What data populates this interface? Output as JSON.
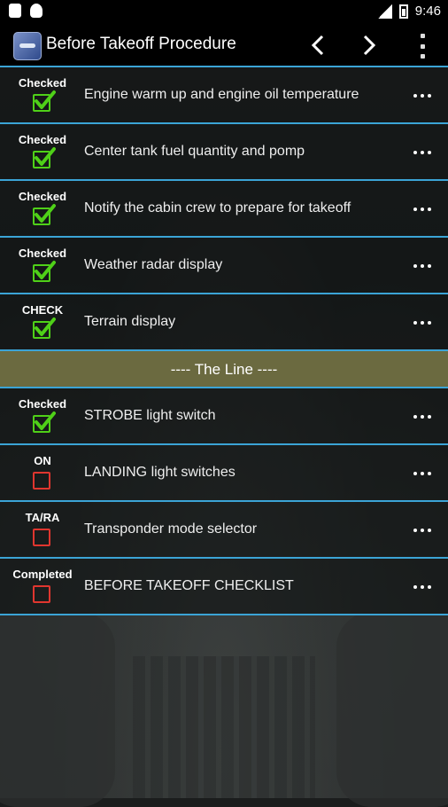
{
  "status_bar": {
    "time": "9:46"
  },
  "app": {
    "title": "Before Takeoff Procedure"
  },
  "accent": "#3ba4d6",
  "items": [
    {
      "status": "Checked",
      "text": "Engine warm up and engine oil temperature",
      "checked": true
    },
    {
      "status": "Checked",
      "text": "Center tank fuel quantity and pomp",
      "checked": true
    },
    {
      "status": "Checked",
      "text": "Notify the cabin crew to prepare for takeoff",
      "checked": true
    },
    {
      "status": "Checked",
      "text": "Weather radar display",
      "checked": true
    },
    {
      "status": "CHECK",
      "text": "Terrain display",
      "checked": true
    }
  ],
  "divider": {
    "label": "---- The Line ----"
  },
  "items2": [
    {
      "status": "Checked",
      "text": "STROBE light switch",
      "checked": true
    },
    {
      "status": "ON",
      "text": "LANDING light switches",
      "checked": false
    },
    {
      "status": "TA/RA",
      "text": "Transponder mode selector",
      "checked": false
    },
    {
      "status": "Completed",
      "text": "BEFORE TAKEOFF CHECKLIST",
      "checked": false
    }
  ]
}
